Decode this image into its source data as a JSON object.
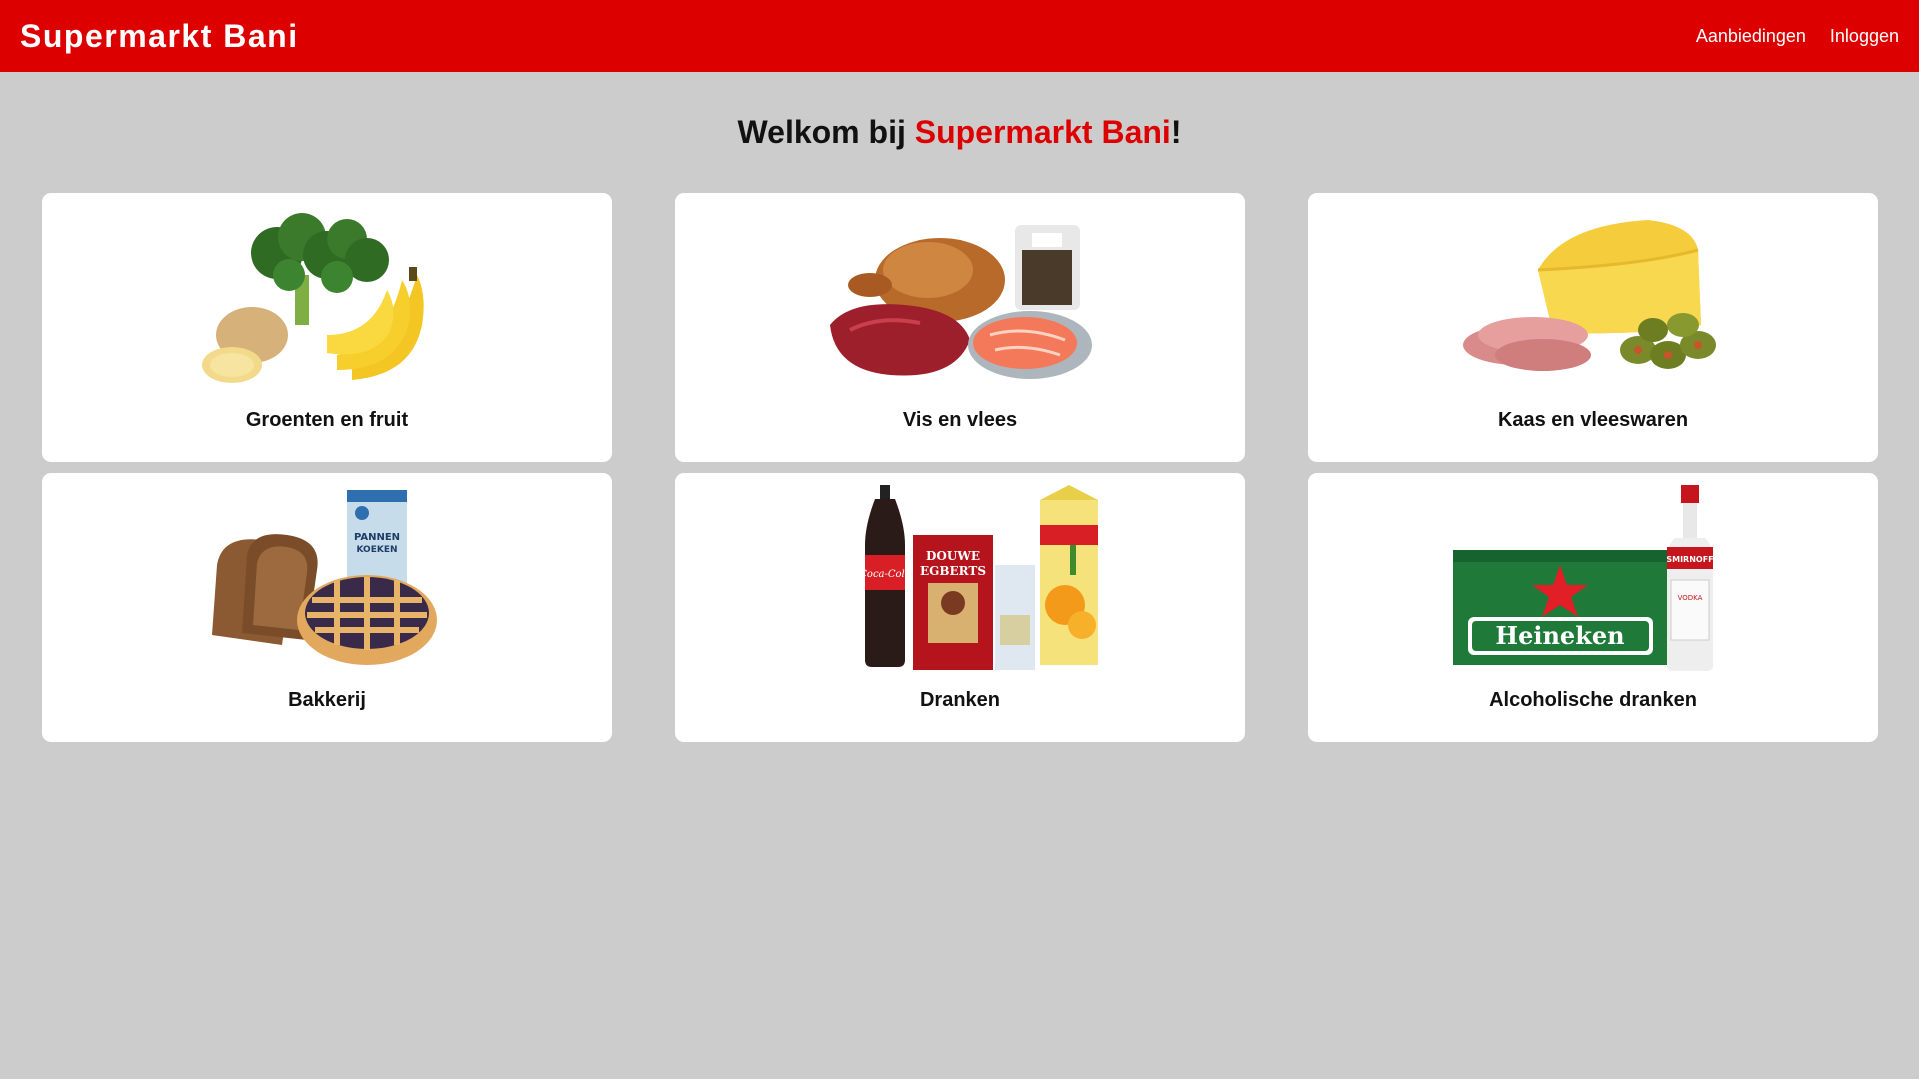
{
  "navbar": {
    "brand": "Supermarkt Bani",
    "links": [
      {
        "label": "Aanbiedingen"
      },
      {
        "label": "Inloggen"
      }
    ]
  },
  "welcome": {
    "prefix": "Welkom bij ",
    "name": "Supermarkt Bani",
    "suffix": "!"
  },
  "categories": [
    {
      "label": "Groenten en fruit",
      "icon": "vegetables-fruit-image"
    },
    {
      "label": "Vis en vlees",
      "icon": "fish-meat-image"
    },
    {
      "label": "Kaas en vleeswaren",
      "icon": "cheese-coldcuts-image"
    },
    {
      "label": "Bakkerij",
      "icon": "bakery-image",
      "package_text": "PANNEN KOEKEN"
    },
    {
      "label": "Dranken",
      "icon": "drinks-image",
      "package_text": "DOUWE EGBERTS"
    },
    {
      "label": "Alcoholische dranken",
      "icon": "alcohol-image",
      "package_text": "Heineken",
      "bottle_text": "SMIRNOFF"
    }
  ],
  "colors": {
    "accent": "#dc0000",
    "background": "#cccccc",
    "card": "#ffffff"
  }
}
